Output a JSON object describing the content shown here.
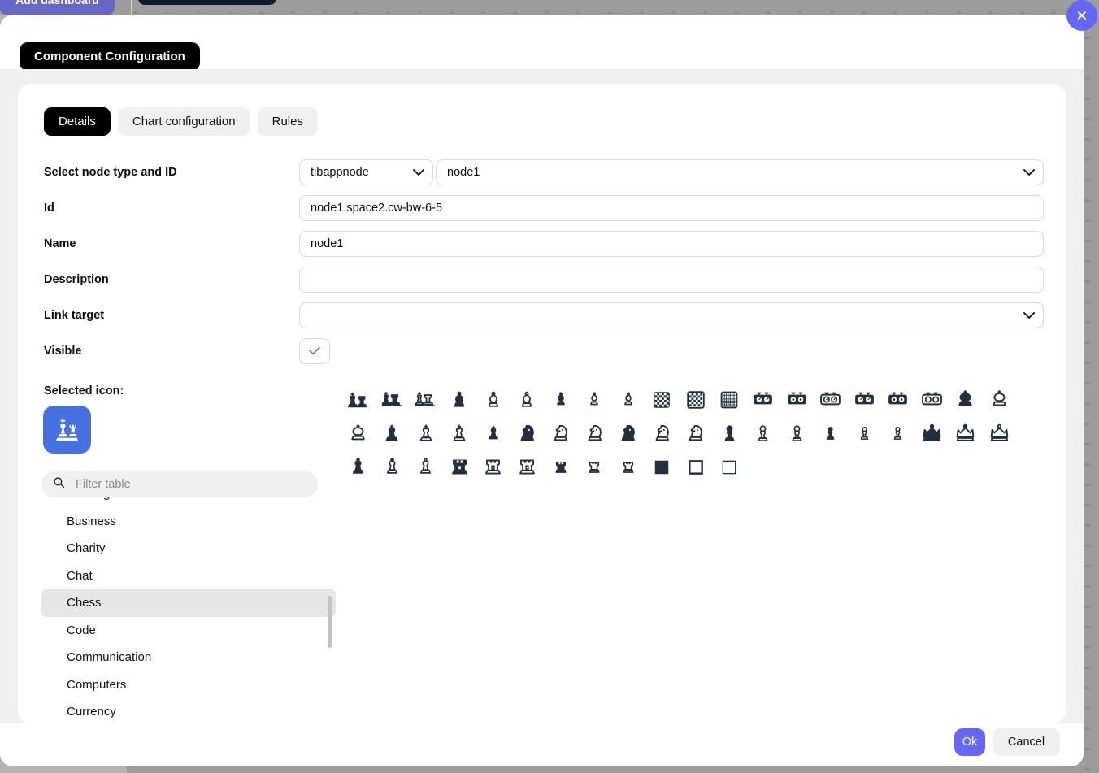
{
  "background": {
    "add_dashboard_label": "Add dashboard"
  },
  "modal": {
    "title": "Component Configuration",
    "close_icon": "close-icon",
    "tabs": [
      {
        "label": "Details",
        "active": true
      },
      {
        "label": "Chart configuration",
        "active": false
      },
      {
        "label": "Rules",
        "active": false
      }
    ],
    "form": {
      "node_type_row": {
        "label": "Select node type and ID",
        "node_type_value": "tibappnode",
        "node_id_value": "node1",
        "chevron_icon": "chevron-down-icon"
      },
      "id_row": {
        "label": "Id",
        "value": "node1.space2.cw-bw-6-5"
      },
      "name_row": {
        "label": "Name",
        "value": "node1"
      },
      "description_row": {
        "label": "Description",
        "value": ""
      },
      "link_target_row": {
        "label": "Link target",
        "value": "",
        "chevron_icon": "chevron-down-icon"
      },
      "visible_row": {
        "label": "Visible",
        "checked": true,
        "check_icon": "check-icon"
      }
    },
    "icon_picker": {
      "selected_icon_label": "Selected icon:",
      "selected_icon_name": "chess-king-rook-icon",
      "selected_icon_bg": "#4471df",
      "filter_placeholder": "Filter table",
      "filter_value": "",
      "search_icon": "search-icon",
      "categories": [
        {
          "label": "Buildings",
          "selected": false
        },
        {
          "label": "Business",
          "selected": false
        },
        {
          "label": "Charity",
          "selected": false
        },
        {
          "label": "Chat",
          "selected": false
        },
        {
          "label": "Chess",
          "selected": true
        },
        {
          "label": "Code",
          "selected": false
        },
        {
          "label": "Communication",
          "selected": false
        },
        {
          "label": "Computers",
          "selected": false
        },
        {
          "label": "Currency",
          "selected": false
        }
      ],
      "icons": [
        {
          "name": "chess-bishop-filled-icon",
          "shape": "bishop",
          "fill": "solid"
        },
        {
          "name": "chess-bishop-board-filled-icon",
          "shape": "bishop2",
          "fill": "solid"
        },
        {
          "name": "chess-bishop-board-outline-icon",
          "shape": "bishop2",
          "fill": "outline"
        },
        {
          "name": "chess-bishop-solid-icon",
          "shape": "bishop3",
          "fill": "solid"
        },
        {
          "name": "chess-bishop-half-icon",
          "shape": "bishop3",
          "fill": "half"
        },
        {
          "name": "chess-bishop-outline-icon",
          "shape": "bishop3",
          "fill": "outline"
        },
        {
          "name": "chess-bishop-thin-solid-icon",
          "shape": "bishop4",
          "fill": "solid"
        },
        {
          "name": "chess-bishop-thin-half-icon",
          "shape": "bishop4",
          "fill": "half"
        },
        {
          "name": "chess-bishop-thin-outline-icon",
          "shape": "bishop4",
          "fill": "outline"
        },
        {
          "name": "chess-board-filled-icon",
          "shape": "board",
          "fill": "solid"
        },
        {
          "name": "chess-board-outline-icon",
          "shape": "board",
          "fill": "half"
        },
        {
          "name": "chess-board-grid-icon",
          "shape": "board",
          "fill": "outline"
        },
        {
          "name": "chess-clock-filled-icon",
          "shape": "clock",
          "fill": "solid"
        },
        {
          "name": "chess-clock-dots-icon",
          "shape": "clock2",
          "fill": "solid"
        },
        {
          "name": "chess-clock-outline-icon",
          "shape": "clock",
          "fill": "outline"
        },
        {
          "name": "chess-clock-alt-filled-icon",
          "shape": "clock",
          "fill": "solid"
        },
        {
          "name": "chess-clock-alt-dots-icon",
          "shape": "clock2",
          "fill": "solid"
        },
        {
          "name": "chess-clock-alt-outline-icon",
          "shape": "clock2",
          "fill": "outline"
        },
        {
          "name": "chess-king-crown-filled-icon",
          "shape": "kingcrown",
          "fill": "solid"
        },
        {
          "name": "chess-king-crown-outline-icon",
          "shape": "kingcrown",
          "fill": "outline"
        },
        {
          "name": "chess-king-crown-thin-icon",
          "shape": "kingcrown",
          "fill": "half"
        },
        {
          "name": "chess-king-filled-icon",
          "shape": "king",
          "fill": "solid"
        },
        {
          "name": "chess-king-half-icon",
          "shape": "king",
          "fill": "half"
        },
        {
          "name": "chess-king-outline-icon",
          "shape": "king",
          "fill": "outline"
        },
        {
          "name": "chess-king-thin-filled-icon",
          "shape": "king2",
          "fill": "solid"
        },
        {
          "name": "chess-knight-filled-icon",
          "shape": "knight",
          "fill": "solid"
        },
        {
          "name": "chess-knight-half-icon",
          "shape": "knight",
          "fill": "half"
        },
        {
          "name": "chess-knight-outline-icon",
          "shape": "knight",
          "fill": "outline"
        },
        {
          "name": "chess-knight-alt-filled-icon",
          "shape": "knight",
          "fill": "solid"
        },
        {
          "name": "chess-knight-alt-half-icon",
          "shape": "knight",
          "fill": "half"
        },
        {
          "name": "chess-knight-alt-outline-icon",
          "shape": "knight",
          "fill": "outline"
        },
        {
          "name": "chess-pawn-filled-icon",
          "shape": "pawn",
          "fill": "solid"
        },
        {
          "name": "chess-pawn-half-icon",
          "shape": "pawn",
          "fill": "half"
        },
        {
          "name": "chess-pawn-outline-icon",
          "shape": "pawn",
          "fill": "outline"
        },
        {
          "name": "chess-pawn-thin-filled-icon",
          "shape": "pawn2",
          "fill": "solid"
        },
        {
          "name": "chess-pawn-thin-half-icon",
          "shape": "pawn2",
          "fill": "half"
        },
        {
          "name": "chess-pawn-thin-outline-icon",
          "shape": "pawn2",
          "fill": "outline"
        },
        {
          "name": "chess-queen-filled-icon",
          "shape": "queen",
          "fill": "solid"
        },
        {
          "name": "chess-queen-half-icon",
          "shape": "queen",
          "fill": "half"
        },
        {
          "name": "chess-queen-outline-icon",
          "shape": "queen",
          "fill": "outline"
        },
        {
          "name": "chess-queen-piece-filled-icon",
          "shape": "queenpiece",
          "fill": "solid"
        },
        {
          "name": "chess-queen-piece-half-icon",
          "shape": "queenpiece",
          "fill": "half"
        },
        {
          "name": "chess-queen-piece-outline-icon",
          "shape": "queenpiece",
          "fill": "outline"
        },
        {
          "name": "chess-rook-filled-icon",
          "shape": "rook",
          "fill": "solid"
        },
        {
          "name": "chess-rook-half-icon",
          "shape": "rook",
          "fill": "half"
        },
        {
          "name": "chess-rook-outline-icon",
          "shape": "rook",
          "fill": "outline"
        },
        {
          "name": "chess-rook-thin-filled-icon",
          "shape": "rook2",
          "fill": "solid"
        },
        {
          "name": "chess-rook-thin-half-icon",
          "shape": "rook2",
          "fill": "half"
        },
        {
          "name": "chess-rook-thin-outline-icon",
          "shape": "rook2",
          "fill": "outline"
        },
        {
          "name": "chess-square-filled-icon",
          "shape": "square",
          "fill": "solid"
        },
        {
          "name": "chess-square-outline-thick-icon",
          "shape": "square",
          "fill": "half"
        },
        {
          "name": "chess-square-outline-thin-icon",
          "shape": "square",
          "fill": "outline"
        }
      ]
    },
    "footer": {
      "ok_label": "Ok",
      "cancel_label": "Cancel"
    }
  },
  "colors": {
    "accent": "#6667f5",
    "icon_dark": "#222f3e",
    "selected_icon_blue": "#4471df",
    "tab_active_bg": "#000000"
  }
}
